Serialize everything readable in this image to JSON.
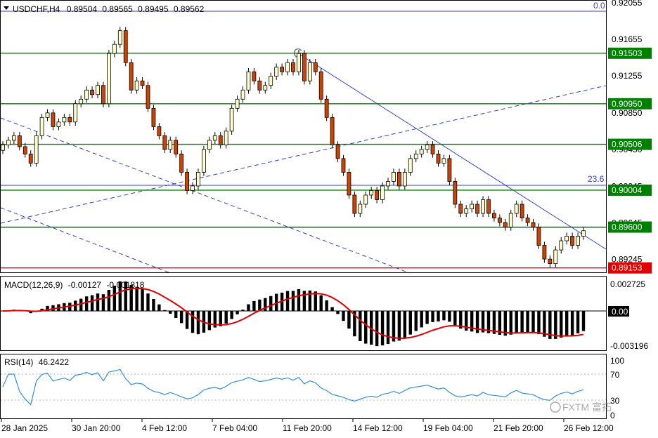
{
  "header": {
    "symbol": "USDCHF,H4",
    "open": "0.89504",
    "high": "0.89565",
    "low": "0.89495",
    "close": "0.89562"
  },
  "colors": {
    "background": "#ffffff",
    "grid": "#c0c0c0",
    "level_green": "#008000",
    "level_red": "#e00000",
    "trend_blue": "#3040c0",
    "candle_bull": "#ffffcc",
    "candle_bear": "#cc4400",
    "macd_hist": "#000000",
    "macd_signal": "#e00000",
    "rsi_line": "#3090e0"
  },
  "price_axis": {
    "ticks": [
      "0.92055",
      "0.91655",
      "0.91255",
      "0.90850",
      "0.90450",
      "0.90045",
      "0.89645",
      "0.89245"
    ]
  },
  "level_tags": [
    {
      "value": 0.91503,
      "label": "0.91503",
      "color": "green"
    },
    {
      "value": 0.9095,
      "label": "0.90950",
      "color": "green"
    },
    {
      "value": 0.90506,
      "label": "0.90506",
      "color": "green"
    },
    {
      "value": 0.90004,
      "label": "0.90004",
      "color": "green"
    },
    {
      "value": 0.896,
      "label": "0.89600",
      "color": "green"
    },
    {
      "value": 0.89153,
      "label": "0.89153",
      "color": "red"
    }
  ],
  "fib_labels": {
    "top": "0.0",
    "mid": "23.6"
  },
  "macd": {
    "title": "MACD(12,26,9)",
    "main_value": "-0.00127",
    "signal_value": "-0.001818",
    "ticks": [
      "0.002725",
      "0.00",
      "-0.003196"
    ]
  },
  "rsi": {
    "title": "RSI(14)",
    "value": "46.2422",
    "ticks": [
      "100",
      "70",
      "30",
      "0"
    ]
  },
  "time_axis": {
    "labels": [
      "28 Jan 2025",
      "30 Jan 20:00",
      "4 Feb 12:00",
      "7 Feb 04:00",
      "11 Feb 20:00",
      "14 Feb 12:00",
      "19 Feb 04:00",
      "21 Feb 20:00",
      "26 Feb 12:00"
    ]
  },
  "watermark": "FXTM 富拓",
  "chart_data": {
    "type": "candlestick",
    "title": "USDCHF,H4",
    "ylim": [
      0.8912,
      0.9207
    ],
    "close": [
      0.905,
      0.9055,
      0.906,
      0.9048,
      0.904,
      0.903,
      0.906,
      0.908,
      0.9085,
      0.907,
      0.9075,
      0.908,
      0.9075,
      0.9095,
      0.91,
      0.911,
      0.9105,
      0.9115,
      0.9095,
      0.915,
      0.916,
      0.9175,
      0.914,
      0.911,
      0.912,
      0.9115,
      0.909,
      0.907,
      0.906,
      0.9045,
      0.9055,
      0.904,
      0.902,
      0.9,
      0.9005,
      0.902,
      0.9045,
      0.9055,
      0.906,
      0.905,
      0.9065,
      0.909,
      0.91,
      0.911,
      0.913,
      0.912,
      0.911,
      0.9115,
      0.9125,
      0.9135,
      0.913,
      0.914,
      0.913,
      0.915,
      0.912,
      0.914,
      0.913,
      0.91,
      0.908,
      0.905,
      0.9035,
      0.902,
      0.8995,
      0.8975,
      0.8985,
      0.8995,
      0.9,
      0.899,
      0.9005,
      0.901,
      0.902,
      0.9005,
      0.902,
      0.9035,
      0.904,
      0.9045,
      0.905,
      0.904,
      0.903,
      0.9035,
      0.901,
      0.8985,
      0.8975,
      0.898,
      0.8985,
      0.8975,
      0.899,
      0.8975,
      0.897,
      0.8965,
      0.896,
      0.8975,
      0.8985,
      0.897,
      0.8965,
      0.896,
      0.894,
      0.8925,
      0.892,
      0.8935,
      0.8945,
      0.895,
      0.894,
      0.895,
      0.8956
    ]
  }
}
